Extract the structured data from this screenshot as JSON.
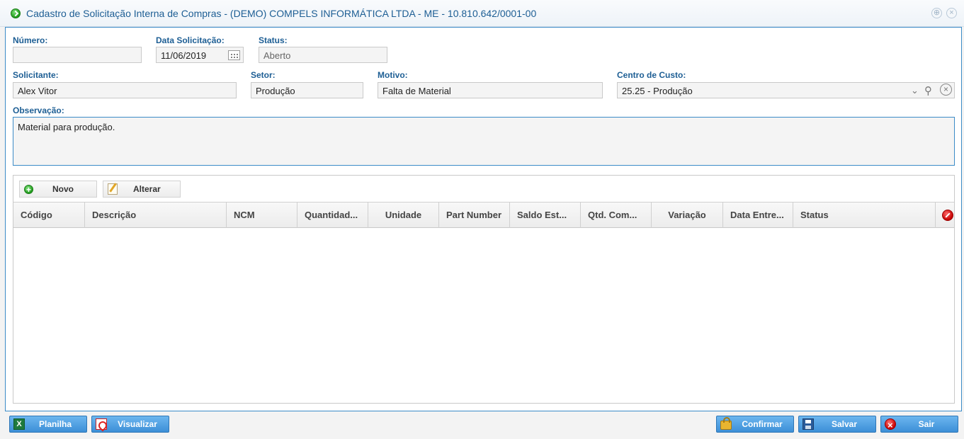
{
  "window": {
    "title": "Cadastro de Solicitação Interna de Compras - (DEMO) COMPELS INFORMÁTICA LTDA - ME - 10.810.642/0001-00"
  },
  "form": {
    "numero": {
      "label": "Número:",
      "value": ""
    },
    "data_solicitacao": {
      "label": "Data Solicitação:",
      "value": "11/06/2019"
    },
    "status": {
      "label": "Status:",
      "value": "Aberto"
    },
    "solicitante": {
      "label": "Solicitante:",
      "value": "Alex Vitor"
    },
    "setor": {
      "label": "Setor:",
      "value": "Produção"
    },
    "motivo": {
      "label": "Motivo:",
      "value": "Falta de Material"
    },
    "centro_custo": {
      "label": "Centro de Custo:",
      "value": "25.25 - Produção"
    },
    "observacao": {
      "label": "Observação:",
      "value": "Material para produção."
    }
  },
  "grid": {
    "toolbar": {
      "novo": "Novo",
      "alterar": "Alterar"
    },
    "columns": [
      "Código",
      "Descrição",
      "NCM",
      "Quantidad...",
      "Unidade",
      "Part Number",
      "Saldo Est...",
      "Qtd. Com...",
      "Variação",
      "Data Entre...",
      "Status"
    ],
    "rows": []
  },
  "footer": {
    "planilha": "Planilha",
    "visualizar": "Visualizar",
    "confirmar": "Confirmar",
    "salvar": "Salvar",
    "sair": "Sair"
  }
}
